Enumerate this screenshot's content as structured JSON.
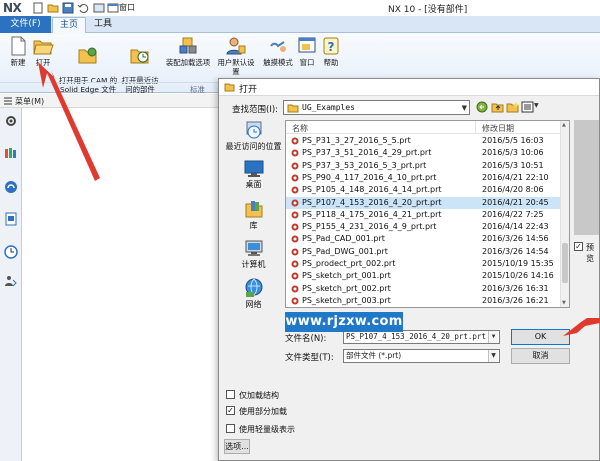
{
  "app": {
    "logo": "NX",
    "window_title": "NX 10 - [没有部件]",
    "qat_window_label": "窗口"
  },
  "ribbon": {
    "file_tab": "文件(F)",
    "tabs": [
      "主页",
      "工具"
    ],
    "buttons": [
      {
        "label": "新建",
        "icon": "new-file-icon"
      },
      {
        "label": "打开",
        "icon": "open-folder-icon"
      },
      {
        "label": "打开用于 CAM 的\nSolid Edge 文件",
        "icon": "open-solid-edge-icon"
      },
      {
        "label": "打开最近访\n问的部件",
        "icon": "recent-parts-icon"
      },
      {
        "label": "装配加载选项",
        "icon": "assembly-load-icon"
      },
      {
        "label": "用户默认设置",
        "icon": "user-defaults-icon"
      },
      {
        "label": "触摸模式",
        "icon": "touch-mode-icon"
      },
      {
        "label": "窗口",
        "icon": "window-icon"
      },
      {
        "label": "帮助",
        "icon": "help-icon"
      }
    ],
    "group_label": "标准"
  },
  "left_panel": {
    "menu_label": "菜单(M)"
  },
  "dialog": {
    "title": "打开",
    "look_in_label": "查找范围(I):",
    "look_in_value": "UG_Examples",
    "places": [
      "最近访问的位置",
      "桌面",
      "库",
      "计算机",
      "网络"
    ],
    "columns": {
      "name": "名称",
      "date": "修改日期"
    },
    "files": [
      {
        "name": "PS_P31_3_27_2016_5_5.prt",
        "date": "2016/5/5 16:03"
      },
      {
        "name": "PS_P37_3_51_2016_4_29_prt.prt",
        "date": "2016/5/3 10:06"
      },
      {
        "name": "PS_P37_3_53_2016_5_3_prt.prt",
        "date": "2016/5/3 10:51"
      },
      {
        "name": "PS_P90_4_117_2016_4_10_prt.prt",
        "date": "2016/4/21 22:10"
      },
      {
        "name": "PS_P105_4_148_2016_4_14_prt.prt",
        "date": "2016/4/20 8:06"
      },
      {
        "name": "PS_P107_4_153_2016_4_20_prt.prt",
        "date": "2016/4/21 20:45",
        "selected": true
      },
      {
        "name": "PS_P118_4_175_2016_4_21_prt.prt",
        "date": "2016/4/22 7:25"
      },
      {
        "name": "PS_P155_4_231_2016_4_9_prt.prt",
        "date": "2016/4/14 22:43"
      },
      {
        "name": "PS_Pad_CAD_001.prt",
        "date": "2016/3/26 14:56"
      },
      {
        "name": "PS_Pad_DWG_001.prt",
        "date": "2016/3/26 14:54"
      },
      {
        "name": "PS_prodect_prt_002.prt",
        "date": "2015/10/19 15:35"
      },
      {
        "name": "PS_sketch_prt_001.prt",
        "date": "2015/10/26 14:16"
      },
      {
        "name": "PS_sketch_prt_002.prt",
        "date": "2016/3/26 16:31"
      },
      {
        "name": "PS_sketch_prt_003.prt",
        "date": "2016/3/26 16:21"
      }
    ],
    "file_name_label": "文件名(N):",
    "file_name_value": "PS_P107_4_153_2016_4_20_prt.prt",
    "file_type_label": "文件类型(T):",
    "file_type_value": "部件文件 (*.prt)",
    "ok_label": "OK",
    "cancel_label": "取消",
    "preview_label": "预览",
    "options": [
      {
        "label": "仅加载结构",
        "checked": false
      },
      {
        "label": "使用部分加载",
        "checked": true
      },
      {
        "label": "使用轻量级表示",
        "checked": false
      }
    ],
    "options_button": "选项..."
  },
  "watermark": "www.rjzxw.com",
  "colors": {
    "file_tab": "#2b72c1",
    "selection": "#cce4f7",
    "annotation_arrow": "#e03a2f",
    "watermark_bg": "#1f78c8"
  }
}
